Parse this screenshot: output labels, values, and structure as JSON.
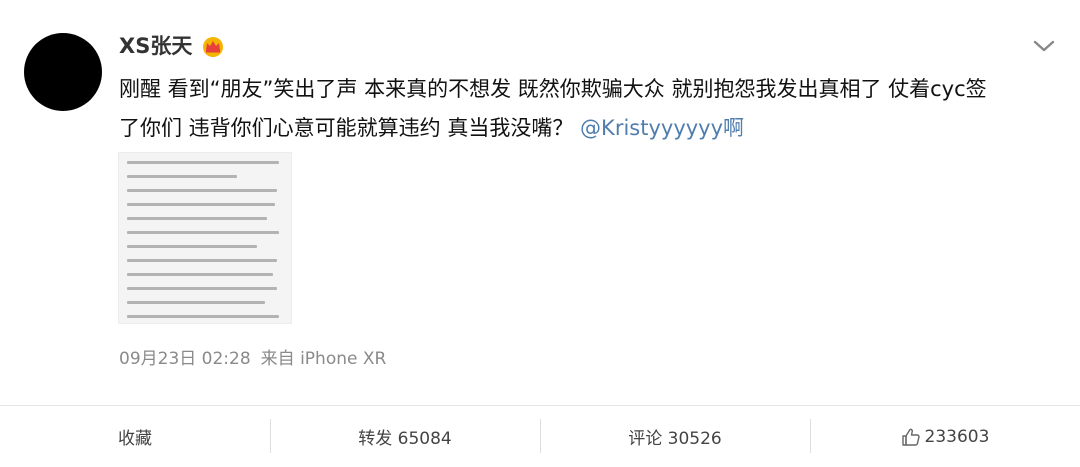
{
  "post": {
    "username": "XS张天",
    "text_line1": "刚醒 看到“朋友”笑出了声 本来真的不想发 既然你欺骗大众 就别抱怨我发出真相了 仗着cyc签",
    "text_line2": "了你们 违背你们心意可能就算违约 真当我没嘴？",
    "mention": "@Kristyyyyyy啊",
    "date": "09月23日 02:28",
    "source": "来自 iPhone XR"
  },
  "actions": {
    "favorite": "收藏",
    "repost": "转发 65084",
    "comment": "评论 30526",
    "like": "233603"
  },
  "icons": {
    "crown": "crown-icon",
    "chevron": "chevron-down-icon",
    "like": "thumbs-up-icon"
  },
  "colors": {
    "mention": "#507daf",
    "crown_gold": "#f5b400",
    "crown_red": "#e8413c"
  }
}
